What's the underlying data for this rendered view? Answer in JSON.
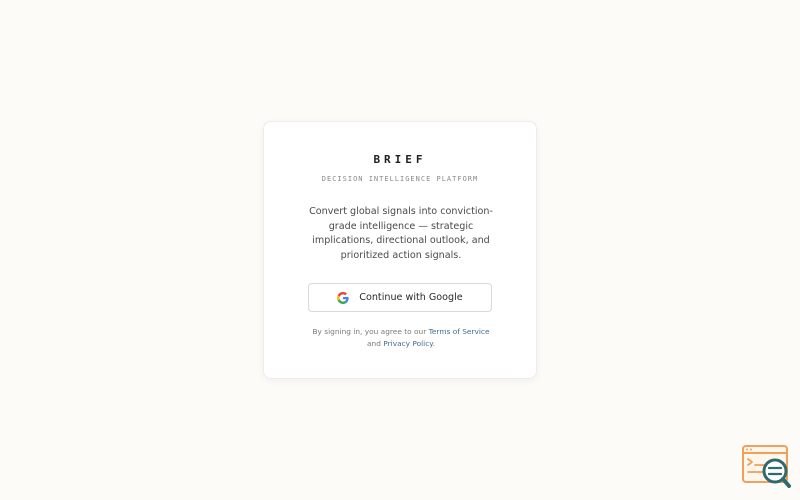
{
  "brand": {
    "name": "BRIEF",
    "tagline": "DECISION INTELLIGENCE PLATFORM"
  },
  "description": "Convert global signals into conviction-grade intelligence — strategic implications, directional outlook, and prioritized action signals.",
  "auth": {
    "google_button_label": "Continue with Google",
    "google_icon": "google-g-icon"
  },
  "legal": {
    "prefix": "By signing in, you agree to our",
    "terms_label": "Terms of Service",
    "conjunction": "and",
    "privacy_label": "Privacy Policy",
    "suffix": "."
  },
  "colors": {
    "background": "#fcfbf8",
    "card": "#ffffff",
    "link": "#3f6f93",
    "widget_orange": "#f0a05a",
    "widget_teal": "#2f6a6e"
  },
  "widget": {
    "icon": "search-window-icon"
  }
}
